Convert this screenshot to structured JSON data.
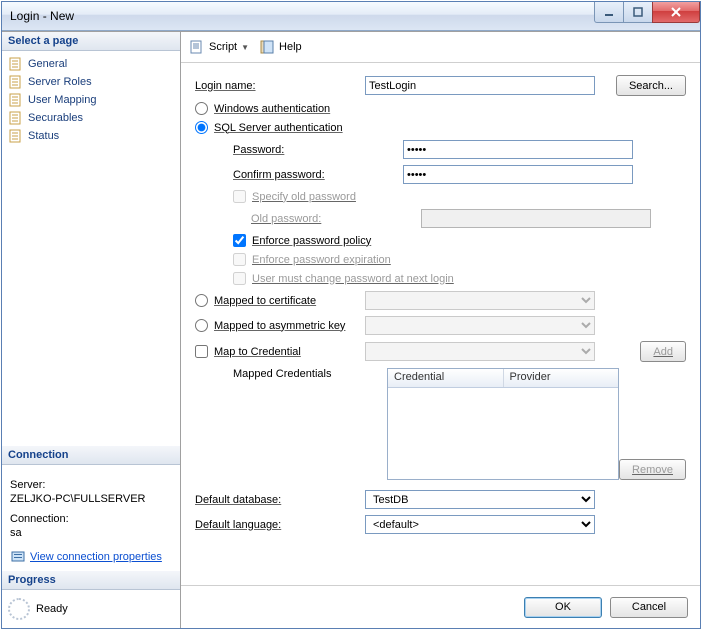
{
  "window": {
    "title": "Login - New"
  },
  "left": {
    "select_page": "Select a page",
    "pages": [
      "General",
      "Server Roles",
      "User Mapping",
      "Securables",
      "Status"
    ],
    "connection_head": "Connection",
    "server_lbl": "Server:",
    "server_val": "ZELJKO-PC\\FULLSERVER",
    "connection_lbl": "Connection:",
    "connection_val": "sa",
    "view_conn": "View connection properties",
    "progress_head": "Progress",
    "ready": "Ready"
  },
  "toolbar": {
    "script": "Script",
    "help": "Help"
  },
  "form": {
    "login_name_lbl": "Login name:",
    "login_name_val": "TestLogin",
    "search_btn": "Search...",
    "win_auth": "Windows authentication",
    "sql_auth": "SQL Server authentication",
    "password_lbl": "Password:",
    "password_val": "•••••",
    "confirm_lbl": "Confirm password:",
    "confirm_val": "•••••",
    "specify_old": "Specify old password",
    "old_pw_lbl": "Old password:",
    "enforce_policy": "Enforce password policy",
    "enforce_exp": "Enforce password expiration",
    "must_change": "User must change password at next login",
    "mapped_cert": "Mapped to certificate",
    "mapped_asym": "Mapped to asymmetric key",
    "map_cred": "Map to Credential",
    "add_btn": "Add",
    "mapped_credentials": "Mapped Credentials",
    "cred_col1": "Credential",
    "cred_col2": "Provider",
    "remove_btn": "Remove",
    "default_db_lbl": "Default database:",
    "default_db_val": "TestDB",
    "default_lang_lbl": "Default language:",
    "default_lang_val": "<default>"
  },
  "footer": {
    "ok": "OK",
    "cancel": "Cancel"
  }
}
